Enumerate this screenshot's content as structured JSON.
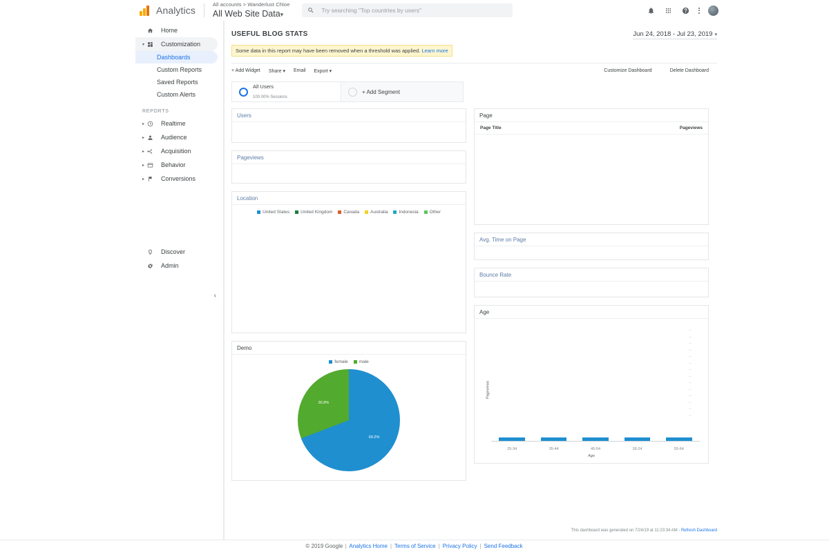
{
  "header": {
    "brand": "Analytics",
    "breadcrumb": "All accounts > Wanderlust Chloe",
    "property": "All Web Site Data",
    "property_caret": "▾",
    "search_placeholder": "Try searching \"Top countries by users\"",
    "search_value": "",
    "icons": {
      "search": "search-icon",
      "notifications": "bell-icon",
      "apps": "apps-grid-icon",
      "help": "help-icon",
      "more": "kebab-menu-icon",
      "avatar": "user-avatar"
    }
  },
  "sidebar": {
    "home": "Home",
    "customization": "Customization",
    "custom_items": [
      "Dashboards",
      "Custom Reports",
      "Saved Reports",
      "Custom Alerts"
    ],
    "reports_label": "REPORTS",
    "reports": [
      "Realtime",
      "Audience",
      "Acquisition",
      "Behavior",
      "Conversions"
    ],
    "bottom": [
      "Discover",
      "Admin"
    ],
    "collapse": "‹",
    "active_item": "Dashboards",
    "expand_arrow": "▸",
    "collapse_arrow": "▾"
  },
  "dashboard": {
    "title": "USEFUL BLOG STATS",
    "date_range": "Jun 24, 2018 - Jul 23, 2019",
    "date_caret": "▾",
    "notice_text": "Some data in this report may have been removed when a threshold was applied.",
    "notice_link": "Learn more",
    "toolbar": {
      "add_widget": "+ Add Widget",
      "share": "Share ▾",
      "email": "Email",
      "export": "Export ▾",
      "customize": "Customize Dashboard",
      "delete": "Delete Dashboard"
    },
    "segments": {
      "all_users_title": "All Users",
      "all_users_sub": "100.00% Sessions",
      "add_segment": "+ Add Segment"
    },
    "generated_text": "This dashboard was generated on 7/24/19 at 11:23:34 AM -",
    "refresh_link": "Refresh Dashboard"
  },
  "widgets": {
    "users": "Users",
    "pageviews": "Pageviews",
    "location": "Location",
    "demo": "Demo",
    "page": "Page",
    "avg_time": "Avg. Time on Page",
    "bounce_rate": "Bounce Rate",
    "age": "Age"
  },
  "page_table": {
    "columns": [
      "Page Title",
      "Pageviews"
    ],
    "rows": []
  },
  "chart_data": [
    {
      "type": "pie",
      "title": "Demo",
      "labels": [
        "female",
        "male"
      ],
      "values": [
        69.2,
        30.8
      ],
      "value_labels": [
        "69.2%",
        "30.8%"
      ],
      "colors": [
        "#1f8fd0",
        "#52aa2e"
      ],
      "legend_position": "top"
    },
    {
      "type": "bar",
      "title": "Age",
      "categories": [
        "25-34",
        "35-44",
        "45-54",
        "18-24",
        "55-64"
      ],
      "values": [
        3,
        3,
        3,
        3,
        3
      ],
      "xlabel": "Age",
      "ylabel": "Pageviews",
      "ylim": [
        0,
        100
      ],
      "grid": false,
      "color": "#1f8fd0"
    },
    {
      "type": "legend",
      "title": "Location",
      "labels": [
        "United States",
        "United Kingdom",
        "Canada",
        "Australia",
        "Indonesia",
        "Other"
      ],
      "colors": [
        "#1f8fd0",
        "#1a7e3c",
        "#e05d2b",
        "#f2d024",
        "#1fa8c4",
        "#5ec45e"
      ],
      "values": [],
      "legend_position": "top"
    }
  ],
  "footer": {
    "copyright": "© 2019 Google",
    "links": [
      "Analytics Home",
      "Terms of Service",
      "Privacy Policy",
      "Send Feedback"
    ],
    "separator": "|"
  }
}
